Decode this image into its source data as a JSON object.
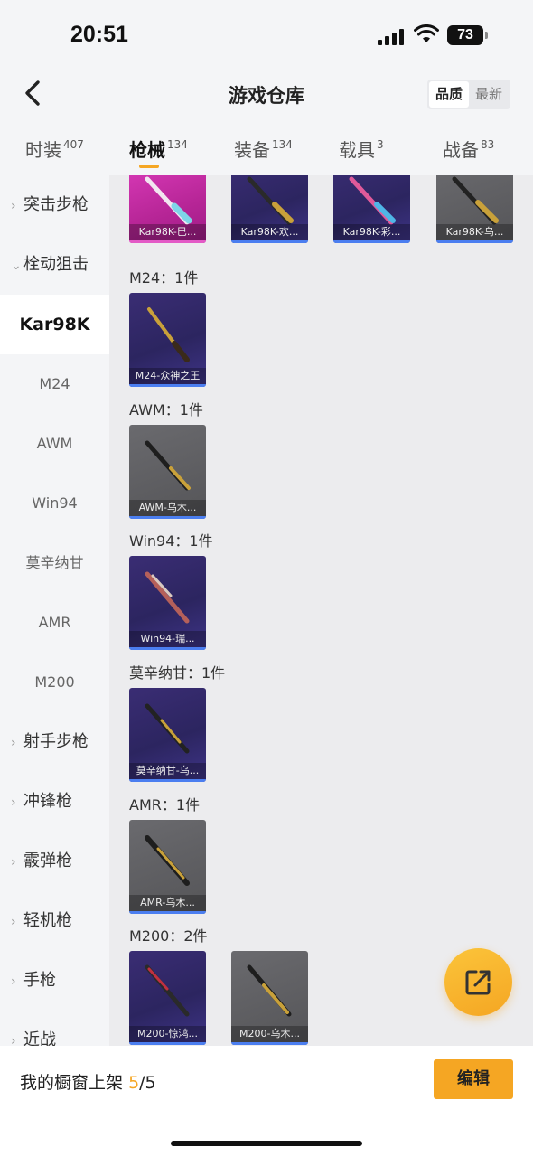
{
  "status": {
    "time": "20:51",
    "battery": "73"
  },
  "header": {
    "title": "游戏仓库",
    "sort_options": [
      "品质",
      "最新"
    ],
    "active_sort": "品质"
  },
  "tabs": [
    {
      "label": "时装",
      "count": "407"
    },
    {
      "label": "枪械",
      "count": "134",
      "active": true
    },
    {
      "label": "装备",
      "count": "134"
    },
    {
      "label": "载具",
      "count": "3"
    },
    {
      "label": "战备",
      "count": "83"
    }
  ],
  "sidebar": {
    "items": [
      {
        "label": "突击步枪",
        "kind": "category",
        "chevron": "›"
      },
      {
        "label": "栓动狙击",
        "kind": "category",
        "chevron": "⌄",
        "expanded": true
      },
      {
        "label": "Kar98K",
        "kind": "sub",
        "active": true
      },
      {
        "label": "M24",
        "kind": "sub"
      },
      {
        "label": "AWM",
        "kind": "sub"
      },
      {
        "label": "Win94",
        "kind": "sub"
      },
      {
        "label": "莫辛纳甘",
        "kind": "sub"
      },
      {
        "label": "AMR",
        "kind": "sub"
      },
      {
        "label": "M200",
        "kind": "sub"
      },
      {
        "label": "射手步枪",
        "kind": "category",
        "chevron": "›"
      },
      {
        "label": "冲锋枪",
        "kind": "category",
        "chevron": "›"
      },
      {
        "label": "霰弹枪",
        "kind": "category",
        "chevron": "›"
      },
      {
        "label": "轻机枪",
        "kind": "category",
        "chevron": "›"
      },
      {
        "label": "手枪",
        "kind": "category",
        "chevron": "›"
      },
      {
        "label": "近战",
        "kind": "category",
        "chevron": "›"
      }
    ]
  },
  "groups": [
    {
      "label": "",
      "items": [
        {
          "name": "Kar98K-巳...",
          "quality": "pink"
        },
        {
          "name": "Kar98K-欢...",
          "quality": "purple"
        },
        {
          "name": "Kar98K-彩...",
          "quality": "purple"
        },
        {
          "name": "Kar98K-乌...",
          "quality": "gray"
        }
      ]
    },
    {
      "label": "M24：1件",
      "items": [
        {
          "name": "M24-众神之王",
          "quality": "purple"
        }
      ]
    },
    {
      "label": "AWM：1件",
      "items": [
        {
          "name": "AWM-乌木...",
          "quality": "gray"
        }
      ]
    },
    {
      "label": "Win94：1件",
      "items": [
        {
          "name": "Win94-瑞...",
          "quality": "purple"
        }
      ]
    },
    {
      "label": "莫辛纳甘：1件",
      "items": [
        {
          "name": "莫辛纳甘-乌...",
          "quality": "purple"
        }
      ]
    },
    {
      "label": "AMR：1件",
      "items": [
        {
          "name": "AMR-乌木...",
          "quality": "gray"
        }
      ]
    },
    {
      "label": "M200：2件",
      "items": [
        {
          "name": "M200-惊鸿...",
          "quality": "purple"
        },
        {
          "name": "M200-乌木...",
          "quality": "gray"
        }
      ]
    }
  ],
  "bottom": {
    "shelf_label": "我的橱窗上架",
    "shelf_current": "5",
    "shelf_total": "/5",
    "edit_label": "编辑"
  },
  "icons": {
    "back": "chevron-left-icon",
    "fab": "share-external-icon",
    "rifle": "rifle-icon"
  },
  "colors": {
    "accent": "#f5a623",
    "purple_quality": "#3a2d74",
    "gray_quality": "#5e5e62",
    "pink_quality": "#c52fa6"
  }
}
